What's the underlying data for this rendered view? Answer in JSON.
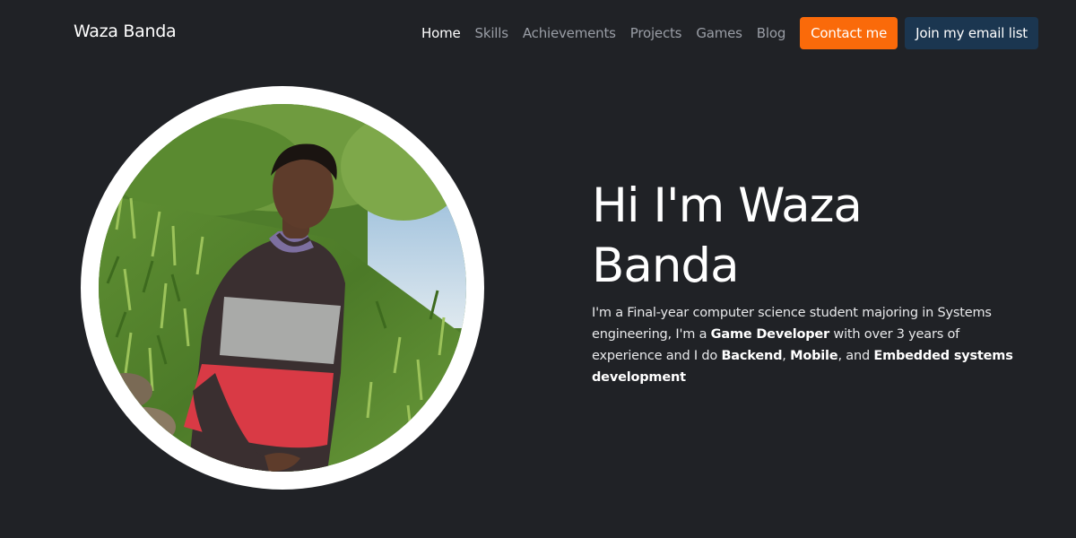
{
  "header": {
    "brand": "Waza Banda",
    "nav": [
      "Home",
      "Skills",
      "Achievements",
      "Projects",
      "Games",
      "Blog"
    ],
    "contact_label": "Contact me",
    "email_label": "Join my email list"
  },
  "colors": {
    "background": "#202226",
    "contact_button": "#fa6a0a",
    "email_button": "#1b3650"
  },
  "hero": {
    "title": "Hi I'm Waza Banda",
    "text": {
      "p1": "I'm a Final-year computer science student majoring in Systems engineering, I'm a ",
      "b1": "Game Developer",
      "p2": " with over 3 years of experience and I do ",
      "b2": "Backend",
      "p3": ", ",
      "b3": "Mobile",
      "p4": ", and ",
      "b4": "Embedded systems development"
    }
  }
}
